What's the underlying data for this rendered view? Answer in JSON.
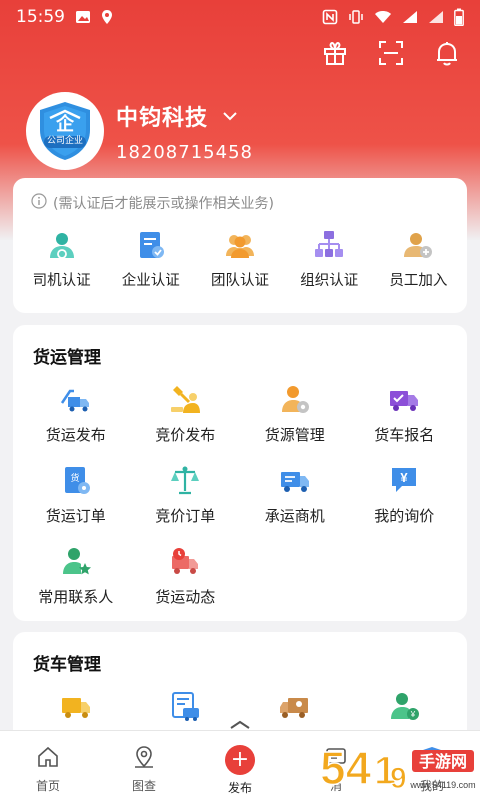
{
  "status_bar": {
    "time": "15:59",
    "icons": [
      "image-icon",
      "location-icon",
      "nfc-icon",
      "vibrate-icon",
      "wifi-icon",
      "signal-icon",
      "battery-icon"
    ]
  },
  "top_actions": [
    "gift-icon",
    "scan-icon",
    "bell-icon"
  ],
  "profile": {
    "badge": "公司企业",
    "name": "中钧科技",
    "phone": "18208715458"
  },
  "certification": {
    "hint": "(需认证后才能展示或操作相关业务)",
    "items": [
      {
        "label": "司机认证",
        "icon": "driver-icon",
        "color": "#2fb3a3"
      },
      {
        "label": "企业认证",
        "icon": "enterprise-doc-icon",
        "color": "#3f8ee8"
      },
      {
        "label": "团队认证",
        "icon": "team-icon",
        "color": "#f2a33a"
      },
      {
        "label": "组织认证",
        "icon": "org-chart-icon",
        "color": "#8c6fe0"
      },
      {
        "label": "员工加入",
        "icon": "employee-add-icon",
        "color": "#e0a24a"
      }
    ]
  },
  "freight": {
    "title": "货运管理",
    "items": [
      {
        "label": "货运发布",
        "icon": "truck-send-icon"
      },
      {
        "label": "竞价发布",
        "icon": "bid-publish-icon"
      },
      {
        "label": "货源管理",
        "icon": "cargo-manage-icon"
      },
      {
        "label": "货车报名",
        "icon": "truck-signup-icon"
      },
      {
        "label": "货运订单",
        "icon": "freight-order-icon"
      },
      {
        "label": "竞价订单",
        "icon": "scale-icon"
      },
      {
        "label": "承运商机",
        "icon": "carrier-truck-icon"
      },
      {
        "label": "我的询价",
        "icon": "inquiry-icon"
      },
      {
        "label": "常用联系人",
        "icon": "contact-star-icon"
      },
      {
        "label": "货运动态",
        "icon": "freight-status-icon"
      }
    ]
  },
  "truck": {
    "title": "货车管理",
    "items": [
      "truck-icon",
      "truck-schedule-icon",
      "truck-person-icon",
      "driver-manage-icon"
    ]
  },
  "tabbar": {
    "items": [
      {
        "label": "首页",
        "icon": "home-icon"
      },
      {
        "label": "图查",
        "icon": "map-pin-icon"
      },
      {
        "label": "发布",
        "icon": "publish-plus-icon"
      },
      {
        "label": "消",
        "icon": "message-icon"
      },
      {
        "label": "我的",
        "icon": "profile-icon"
      }
    ]
  },
  "watermark": {
    "text": "54¹⁄₉手游网"
  }
}
